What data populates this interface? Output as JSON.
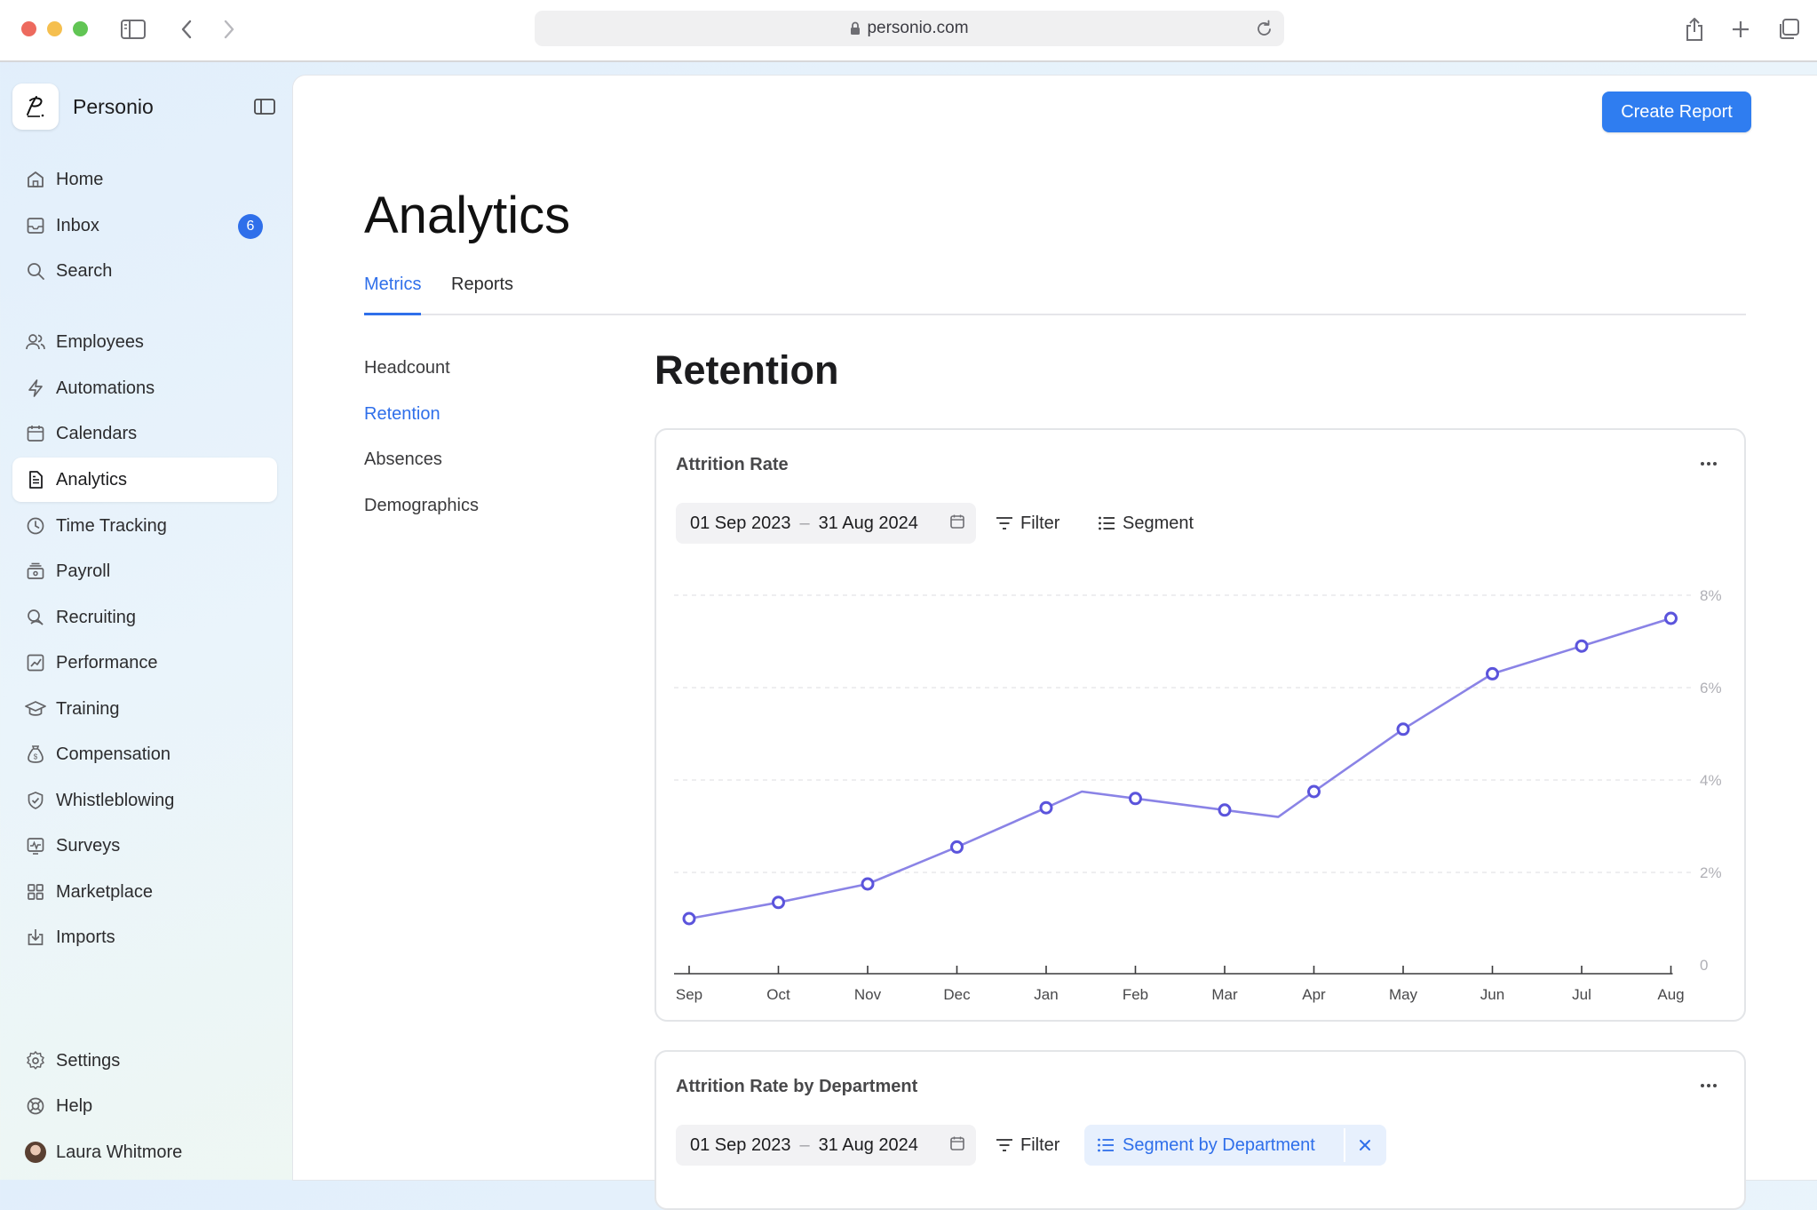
{
  "browser": {
    "url": "personio.com"
  },
  "brand": {
    "name": "Personio"
  },
  "sidebar": {
    "items": [
      {
        "label": "Home",
        "icon": "home-icon"
      },
      {
        "label": "Inbox",
        "icon": "inbox-icon",
        "badge": "6"
      },
      {
        "label": "Search",
        "icon": "search-icon"
      },
      {
        "label": "Employees",
        "icon": "people-icon"
      },
      {
        "label": "Automations",
        "icon": "lightning-icon"
      },
      {
        "label": "Calendars",
        "icon": "calendar-icon"
      },
      {
        "label": "Analytics",
        "icon": "document-icon",
        "active": true
      },
      {
        "label": "Time Tracking",
        "icon": "clock-icon"
      },
      {
        "label": "Payroll",
        "icon": "payroll-icon"
      },
      {
        "label": "Recruiting",
        "icon": "recruiting-icon"
      },
      {
        "label": "Performance",
        "icon": "chart-icon"
      },
      {
        "label": "Training",
        "icon": "graduation-cap-icon"
      },
      {
        "label": "Compensation",
        "icon": "money-bag-icon"
      },
      {
        "label": "Whistleblowing",
        "icon": "shield-icon"
      },
      {
        "label": "Surveys",
        "icon": "survey-icon"
      },
      {
        "label": "Marketplace",
        "icon": "grid-icon"
      },
      {
        "label": "Imports",
        "icon": "import-icon"
      }
    ],
    "footer": [
      {
        "label": "Settings",
        "icon": "gear-icon"
      },
      {
        "label": "Help",
        "icon": "lifebuoy-icon"
      },
      {
        "label": "Laura Whitmore",
        "icon": "avatar"
      }
    ]
  },
  "header": {
    "create_button": "Create Report"
  },
  "page": {
    "title": "Analytics",
    "tabs": [
      {
        "label": "Metrics",
        "active": true
      },
      {
        "label": "Reports"
      }
    ],
    "subnav": [
      {
        "label": "Headcount"
      },
      {
        "label": "Retention",
        "active": true
      },
      {
        "label": "Absences"
      },
      {
        "label": "Demographics"
      }
    ],
    "section_title": "Retention"
  },
  "cards": [
    {
      "title": "Attrition Rate",
      "date_from": "01 Sep 2023",
      "date_sep": "–",
      "date_to": "31 Aug 2024",
      "filter": "Filter",
      "segment": "Segment"
    },
    {
      "title": "Attrition Rate by Department",
      "date_from": "01 Sep 2023",
      "date_sep": "–",
      "date_to": "31 Aug 2024",
      "filter": "Filter",
      "segment": "Segment by Department"
    }
  ],
  "colors": {
    "accent": "#2f6fea",
    "line": "#8a83e6",
    "marker": "#5b54dc"
  },
  "chart_data": {
    "type": "line",
    "title": "Attrition Rate",
    "xlabel": "",
    "ylabel": "",
    "categories": [
      "Sep",
      "Oct",
      "Nov",
      "Dec",
      "Jan",
      "Feb",
      "Mar",
      "Apr",
      "May",
      "Jun",
      "Jul",
      "Aug"
    ],
    "y_ticks": [
      "0",
      "2%",
      "4%",
      "6%",
      "8%"
    ],
    "ylim": [
      0,
      8
    ],
    "grid": true,
    "y_axis_side": "right",
    "series": [
      {
        "x": [
          0,
          1,
          2,
          3,
          4,
          4.4,
          5,
          6,
          6.6,
          7,
          8,
          9,
          10,
          11
        ],
        "values": [
          1.0,
          1.35,
          1.75,
          2.55,
          3.4,
          3.75,
          3.6,
          3.35,
          3.2,
          3.75,
          5.1,
          6.3,
          6.9,
          7.5
        ],
        "markers": [
          true,
          true,
          true,
          true,
          true,
          false,
          true,
          true,
          false,
          true,
          true,
          true,
          true,
          true
        ]
      }
    ]
  }
}
